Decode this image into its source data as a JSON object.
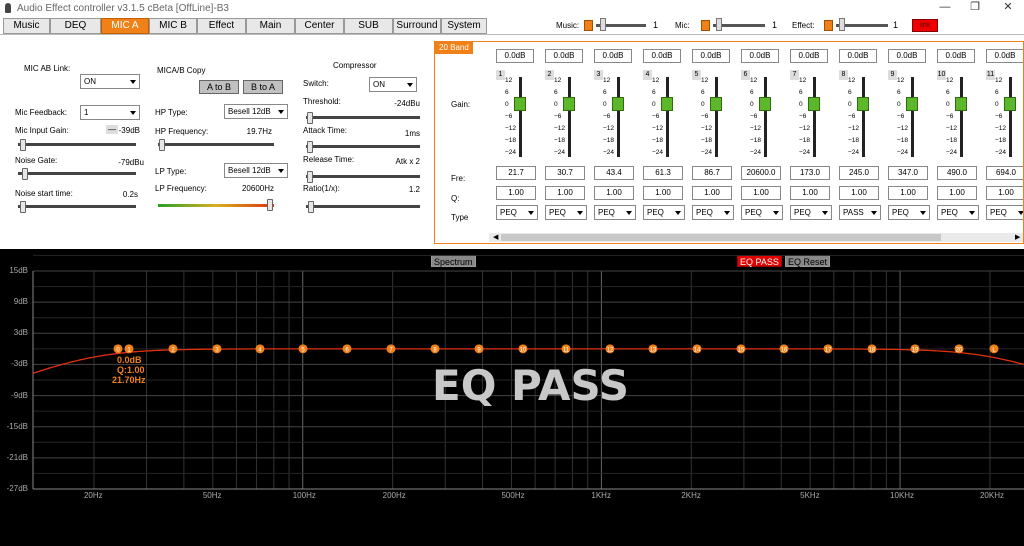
{
  "window": {
    "title": "Audio Effect controller v3.1.5 cBeta [OffLine]-B3",
    "restore_glyph": "❐",
    "close_glyph": "✕",
    "minimize_glyph": "—"
  },
  "tabs": [
    "Music",
    "DEQ",
    "MIC A",
    "MIC B",
    "Effect",
    "Main",
    "Center",
    "SUB",
    "Surround",
    "System"
  ],
  "active_tab": "MIC A",
  "mixer": {
    "music_label": "Music:",
    "music_value": "1",
    "mic_label": "Mic:",
    "mic_value": "1",
    "effect_label": "Effect:",
    "effect_value": "1",
    "link_label": "link",
    "accent": "#f08018"
  },
  "mic": {
    "ab_link_label": "MIC AB Link:",
    "ab_link_value": "ON",
    "feedback_label": "Mic Feedback:",
    "feedback_value": "1",
    "input_gain_label": "Mic Input Gain:",
    "input_gain_value": "-39dB",
    "input_gain_minus": "—",
    "noise_gate_label": "Noise Gate:",
    "noise_gate_value": "-79dBu",
    "noise_start_label": "Noise start time:",
    "noise_start_value": "0.2s"
  },
  "copy": {
    "title": "MICA/B Copy",
    "a_to_b": "A to B",
    "b_to_a": "B to A"
  },
  "filters": {
    "hp_type_label": "HP Type:",
    "hp_type_value": "Besell 12dB",
    "hp_freq_label": "HP Frequency:",
    "hp_freq_value": "19.7Hz",
    "lp_type_label": "LP Type:",
    "lp_type_value": "Besell 12dB",
    "lp_freq_label": "LP Frequency:",
    "lp_freq_value": "20600Hz"
  },
  "compressor": {
    "title": "Compressor",
    "switch_label": "Switch:",
    "switch_value": "ON",
    "threshold_label": "Threshold:",
    "threshold_value": "-24dBu",
    "attack_label": "Attack Time:",
    "attack_value": "1ms",
    "release_label": "Release Time:",
    "release_value": "Atk x 2",
    "ratio_label": "Ratio(1/x):",
    "ratio_value": "1.2"
  },
  "eq": {
    "band_title": "20 Band",
    "gain_label": "Gain:",
    "fre_label": "Fre:",
    "q_label": "Q:",
    "type_label": "Type",
    "scale": [
      "12",
      "6",
      "0",
      "−6",
      "−12",
      "−18",
      "−24"
    ],
    "scroll_left": "◀",
    "scroll_right": "▶",
    "bands": [
      {
        "num": "1",
        "gain": "0.0dB",
        "fre": "21.7",
        "q": "1.00",
        "type": "PEQ"
      },
      {
        "num": "2",
        "gain": "0.0dB",
        "fre": "30.7",
        "q": "1.00",
        "type": "PEQ"
      },
      {
        "num": "3",
        "gain": "0.0dB",
        "fre": "43.4",
        "q": "1.00",
        "type": "PEQ"
      },
      {
        "num": "4",
        "gain": "0.0dB",
        "fre": "61.3",
        "q": "1.00",
        "type": "PEQ"
      },
      {
        "num": "5",
        "gain": "0.0dB",
        "fre": "86.7",
        "q": "1.00",
        "type": "PEQ"
      },
      {
        "num": "6",
        "gain": "0.0dB",
        "fre": "20600.0",
        "q": "1.00",
        "type": "PEQ"
      },
      {
        "num": "7",
        "gain": "0.0dB",
        "fre": "173.0",
        "q": "1.00",
        "type": "PEQ"
      },
      {
        "num": "8",
        "gain": "0.0dB",
        "fre": "245.0",
        "q": "1.00",
        "type": "PASS"
      },
      {
        "num": "9",
        "gain": "0.0dB",
        "fre": "347.0",
        "q": "1.00",
        "type": "PEQ"
      },
      {
        "num": "10",
        "gain": "0.0dB",
        "fre": "490.0",
        "q": "1.00",
        "type": "PEQ"
      },
      {
        "num": "11",
        "gain": "0.0dB",
        "fre": "694.0",
        "q": "1.00",
        "type": "PEQ"
      }
    ]
  },
  "graph": {
    "spectrum_label": "Spectrum",
    "eqpass_btn": "EQ PASS",
    "eqreset_btn": "EQ Reset",
    "overlay": "EQ PASS",
    "info_gain": "0.0dB",
    "info_q": "Q:1.00",
    "info_freq": "21.70Hz",
    "y_labels": [
      "15dB",
      "9dB",
      "3dB",
      "-3dB",
      "-9dB",
      "-15dB",
      "-21dB",
      "-27dB"
    ],
    "x_labels": [
      {
        "t": "20Hz",
        "f": 20
      },
      {
        "t": "50Hz",
        "f": 50
      },
      {
        "t": "100Hz",
        "f": 100
      },
      {
        "t": "200Hz",
        "f": 200
      },
      {
        "t": "500Hz",
        "f": 500
      },
      {
        "t": "1KHz",
        "f": 1000
      },
      {
        "t": "2KHz",
        "f": 2000
      },
      {
        "t": "5KHz",
        "f": 5000
      },
      {
        "t": "10KHz",
        "f": 10000
      },
      {
        "t": "20KHz",
        "f": 20000
      }
    ],
    "markers": [
      "0",
      "1",
      "2",
      "3",
      "4",
      "5",
      "6",
      "7",
      "8",
      "9",
      "10",
      "11",
      "12",
      "13",
      "14",
      "15",
      "16",
      "17",
      "18",
      "19",
      "20",
      "L"
    ],
    "curve_color": "#e03010",
    "marker_color": "#f08018"
  }
}
